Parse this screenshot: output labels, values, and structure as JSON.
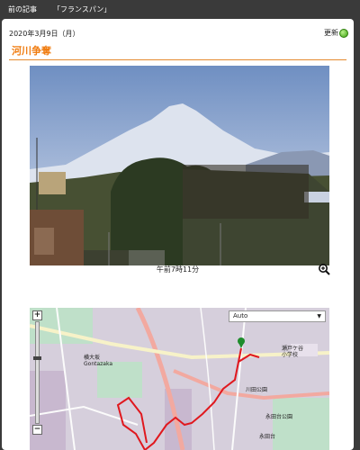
{
  "topbar": {
    "prev_label": "前の記事",
    "next_label": "「フランスパン」"
  },
  "post": {
    "date": "2020年3月9日（月）",
    "update_label": "更新",
    "title": "河川争奪",
    "photo_caption": "午前7時11分"
  },
  "map": {
    "select_value": "Auto",
    "zoom_in": "+",
    "zoom_out": "−",
    "labels": {
      "place1": "横大坂",
      "place1_en": "Gontazaka",
      "place2": "瀬戸ケ谷",
      "place2b": "小学校",
      "place3": "川田公園",
      "place4": "永田台公園",
      "place5": "永田台"
    }
  },
  "colors": {
    "accent": "#f07d12",
    "route": "#e0181e",
    "card_bg": "#ffffff",
    "page_bg": "#3a3a3a"
  }
}
